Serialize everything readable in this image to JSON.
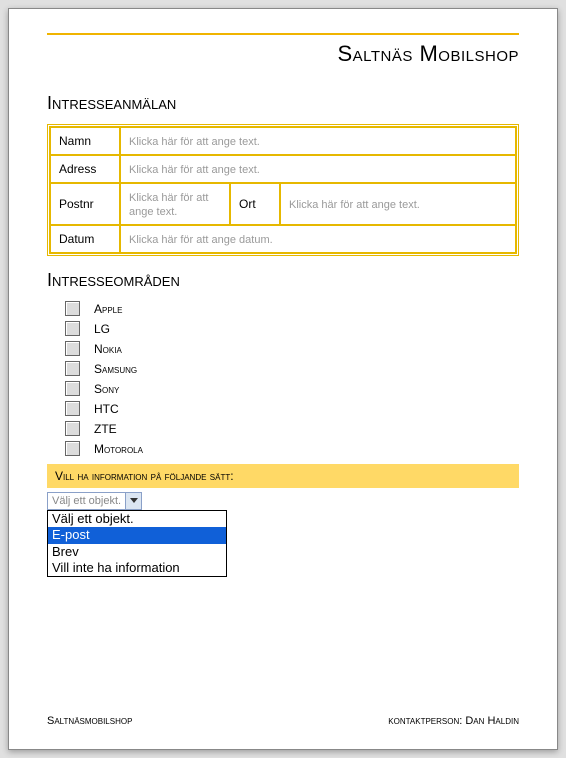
{
  "company": "Saltnäs Mobilshop",
  "section1": "Intresseanmälan",
  "form": {
    "name_label": "Namn",
    "name_ph": "Klicka här för att ange text.",
    "address_label": "Adress",
    "address_ph": "Klicka här för att ange text.",
    "postnr_label": "Postnr",
    "postnr_ph": "Klicka här för att ange text.",
    "ort_label": "Ort",
    "ort_ph": "Klicka här för att ange text.",
    "date_label": "Datum",
    "date_ph": "Klicka här för att ange datum."
  },
  "section2": "Intresseområden",
  "brands": [
    "Apple",
    "LG",
    "Nokia",
    "Samsung",
    "Sony",
    "HTC",
    "ZTE",
    "Motorola"
  ],
  "info_bar": "Vill ha information på följande sätt:",
  "combo_text": "Välj ett objekt.",
  "options": [
    "Välj ett objekt.",
    "E-post",
    "Brev",
    "Vill inte ha information"
  ],
  "selected_index": 1,
  "footer_left": "Saltnäsmobilshop",
  "footer_right": "kontaktperson: Dan Haldin"
}
